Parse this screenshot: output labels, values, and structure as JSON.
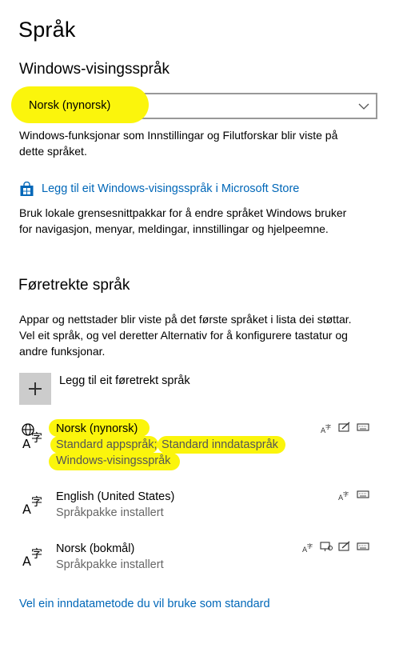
{
  "page": {
    "title": "Språk"
  },
  "display_language": {
    "heading": "Windows-visingsspråk",
    "selected": "Norsk (nynorsk)",
    "description_line1": "Windows-funksjonar som Innstillingar og Filutforskar blir viste på",
    "description_line2": "dette språket.",
    "store_link": "Legg til eit Windows-visingsspråk i Microsoft Store",
    "store_desc_line1": "Bruk lokale grensesnittpakkar for å endre språket Windows bruker",
    "store_desc_line2": "for navigasjon, menyar, meldingar, innstillingar og hjelpeemne."
  },
  "preferred": {
    "heading": "Føretrekte språk",
    "description_line1": "Appar og nettstader blir viste på det første språket i lista dei støttar.",
    "description_line2": "Vel eit språk, og vel deretter Alternativ for å konfigurere tastatur og",
    "description_line3": "andre funksjonar.",
    "add_label": "Legg til eit føretrekt språk",
    "languages": [
      {
        "name": "Norsk (nynorsk)",
        "sub1": "Standard appspråk;",
        "sub2": "Standard inndataspråk",
        "sub3": "Windows-visingsspråk"
      },
      {
        "name": "English (United States)",
        "sub1": "Språkpakke installert"
      },
      {
        "name": "Norsk (bokmål)",
        "sub1": "Språkpakke installert"
      }
    ]
  },
  "footer": {
    "link": "Vel ein inndatametode du vil bruke som standard"
  },
  "colors": {
    "highlight": "#fbf50c",
    "link": "#0067b8",
    "secondary_text": "#666666"
  }
}
